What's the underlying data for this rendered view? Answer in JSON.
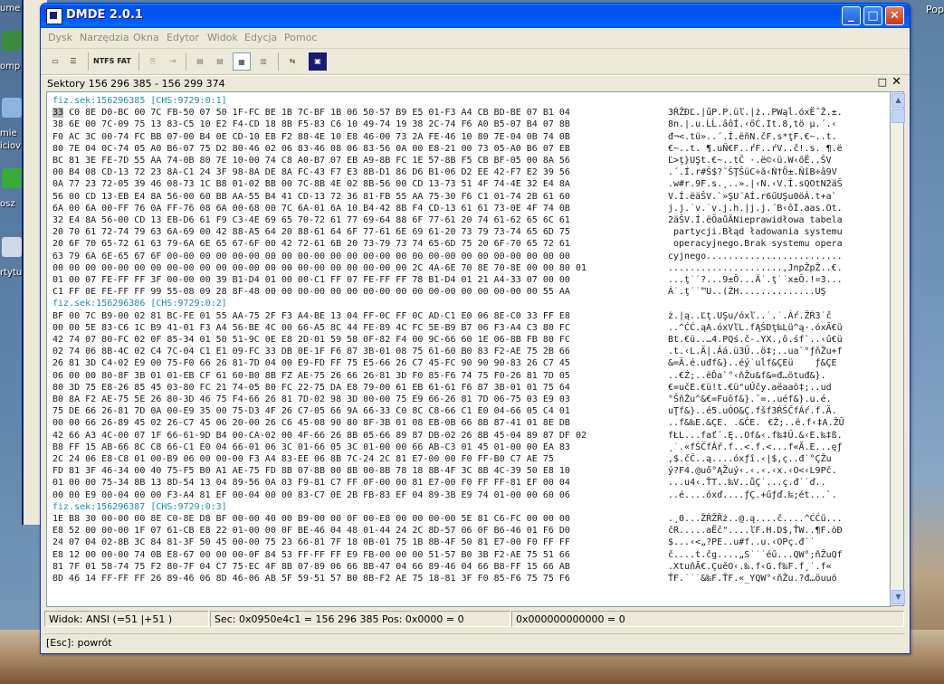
{
  "desktop": {
    "left_labels": [
      "ume",
      "omp",
      "mie",
      "iciov",
      "osz",
      "rtytu"
    ],
    "right_label": "Pop"
  },
  "window": {
    "title": "DMDE 2.0.1",
    "controls": {
      "minimize": "_",
      "maximize": "□",
      "close": "✕"
    }
  },
  "menu": [
    "Dysk",
    "Narzędzia",
    "Okna",
    "Edytor",
    "Widok",
    "Edycja",
    "Pomoc"
  ],
  "toolbar": {
    "ntfs_label": "NTFS",
    "fat_label": "FAT",
    "icons": [
      "drive-icon",
      "partition-icon",
      "ntfs-icon",
      "fat-icon",
      "copy-icon",
      "paste-icon",
      "view-list-icon",
      "view-details-icon",
      "view-hex-icon",
      "view-split-icon",
      "tree-icon",
      "app-icon"
    ]
  },
  "panel": {
    "title": "Sektory 156 296 385 - 156 299 374",
    "maximize": "□",
    "close": "✕"
  },
  "hex": [
    {
      "type": "sec",
      "text": "fiz.sek:156296385 [CHS:9729:0:1]"
    },
    {
      "type": "data",
      "hex": "33 C0 8E D0-BC 00 7C FB-50 07 50 1F-FC BE 1B 7C-BF 1B 06 50-57 B9 E5 01-F3 A4 CB BD-BE 07 B1 04",
      "ascii": "3ŔŽĐĽ.|űP.P.üľ.|ż..PWąĺ.óxË˝Ž.±."
    },
    {
      "type": "data",
      "hex": "38 6E 00 7C-09 75 13 83-C5 10 E2 F4-CD 18 8B F5-83 C6 10 49-74 19 38 2C-74 F6 A0 B5-07 B4 07 8B",
      "ascii": "8n.|.u.ĹĹ.âôÍ.‹őĆ.It.8,tö µ.´.‹"
    },
    {
      "type": "data",
      "hex": "F0 AC 3C 00-74 FC BB 07-00 B4 0E CD-10 EB F2 88-4E 10 E8 46-00 73 2A FE-46 10 80 7E-04 0B 74 0B",
      "ascii": "đ¬<.tü»..´.Í.ëňN.čF.s*ţF.€~..t."
    },
    {
      "type": "data",
      "hex": "80 7E 04 0C-74 05 A0 B6-07 75 D2 80-46 02 06 83-46 08 06 83-56 0A 00 E8-21 00 73 05-A0 B6 07 EB",
      "ascii": "€~..t. ¶.uŇ€F..ŕF..ŕV..č!.s. ¶.ë"
    },
    {
      "type": "data",
      "hex": "BC 81 3E FE-7D 55 AA 74-0B 80 7E 10-00 74 C8 A0-B7 07 EB A9-8B FC 1E 57-8B F5 CB BF-05 00 8A 56",
      "ascii": "Ľ>ţ}UŞt.€~..tČ ·.ë©‹ü.W‹őË..ŠV"
    },
    {
      "type": "data",
      "hex": "00 B4 08 CD-13 72 23 8A-C1 24 3F 98-8A DE 8A FC-43 F7 E3 8B-D1 86 D6 B1-06 D2 EE 42-F7 E2 39 56",
      "ascii": ".´.Í.r#Š$?˜ŠŢŠüC÷ă‹Ń†Ö±.ŇîB÷â9V"
    },
    {
      "type": "data",
      "hex": "0A 77 23 72-05 39 46 08-73 1C B8 01-02 BB 00 7C-8B 4E 02 8B-56 00 CD 13-73 51 4F 74-4E 32 E4 8A",
      "ascii": ".w#r.9F.s.¸..».|‹N.‹V.Í.sQOtN2äŠ"
    },
    {
      "type": "data",
      "hex": "56 00 CD 13-EB E4 8A 56-00 60 BB AA-55 B4 41 CD-13 72 36 81-FB 55 AA 75-30 F6 C1 01-74 2B 61 60",
      "ascii": "V.Í.ëäŠV.`»ŞU´AÍ.r6űUŞu0öÁ.t+a`"
    },
    {
      "type": "data",
      "hex": "6A 00 6A 00-FF 76 0A FF-76 08 6A 00-68 00 7C 6A-01 6A 10 B4-42 8B F4 CD-13 61 61 73-0E 4F 74 0B",
      "ascii": "j.j.˙v.˙v.j.h.|j.j.´B‹ôÍ.aas.Ot."
    },
    {
      "type": "data",
      "hex": "32 E4 8A 56-00 CD 13 EB-D6 61 F9 C3-4E 69 65 70-72 61 77 69-64 88 6F 77-61 20 74 61-62 65 6C 61",
      "ascii": "2äŠV.Í.ëÖaůĂNieprawidłowa tabela"
    },
    {
      "type": "data",
      "hex": "20 70 61 72-74 79 63 6A-69 00 42 88-A5 64 20 88-61 64 6F 77-61 6E 69 61-20 73 79 73-74 65 6D 75",
      "ascii": " partycji.Błąd ładowania systemu"
    },
    {
      "type": "data",
      "hex": "20 6F 70 65-72 61 63 79-6A 6E 65 67-6F 00 42 72-61 6B 20 73-79 73 74 65-6D 75 20 6F-70 65 72 61",
      "ascii": " operacyjnego.Brak systemu opera"
    },
    {
      "type": "data",
      "hex": "63 79 6A 6E-65 67 6F 00-00 00 00 00-00 00 00 00-00 00 00 00-00 00 00 00-00 00 00 00-00 00 00 00",
      "ascii": "cyjnego........................."
    },
    {
      "type": "data",
      "hex": "00 00 00 00-00 00 00 00-00 00 00 00-00 00 00 00-00 00 00 00-00 00 2C 4A-6E 70 8E 70-8E 00 00 80 01",
      "ascii": ".....................,JnpŽpŽ..€."
    },
    {
      "type": "data",
      "hex": "01 00 07 FE-FF FF 3F 00-00 00 39 B1-D4 01 00 00-C1 FF 07 FE-FF FF 78 B1-D4 01 21 A4-33 07 00 00",
      "ascii": "...ţ˙˙?...9±Ô...Á˙.ţ˙˙x±Ô.!¤3..."
    },
    {
      "type": "data",
      "hex": "C1 FF 0E FE-FF FF 99 55-08 09 28 8F-48 00 00 00-00 00 00 00-00 00 00 00-00 00 00 00-00 00 55 AA",
      "ascii": "Á˙.ţ˙˙™U..(ŹH..............UŞ"
    },
    {
      "type": "sec",
      "text": "fiz.sek:156296386 [CHS:9729:0:2]"
    },
    {
      "type": "data",
      "hex": "BF 00 7C B9-00 02 81 BC-FE 01 55 AA-75 2F F3 A4-BE 13 04 FF-0C FF 0C AD-C1 E0 06 8E-C0 33 FF E8",
      "ascii": "ż.|ą..Ľţ.UŞu/óxľ..˙.˙.­Áŕ.ŽŔ3˙č"
    },
    {
      "type": "data",
      "hex": "00 00 5E 83-C6 1C B9 41-01 F3 A4 56-BE 4C 00 66-A5 8C 44 FE-89 4C FC 5E-B9 B7 06 F3-A4 C3 80 FC",
      "ascii": "..^ĆĆ.ąA.óxVľL.fĄŚDţ‰Lü^ą·.óxĂ€ü"
    },
    {
      "type": "data",
      "hex": "42 74 07 80-FC 02 0F 85-34 01 50 51-9C 0E E8 2D-01 59 58 0F-82 F4 00 9C-66 60 1E 06-8B FB 80 FC",
      "ascii": "Bt.€ü..…4.PQś.č-.YX.‚ô.śf`..‹ű€ü"
    },
    {
      "type": "data",
      "hex": "02 74 06 8B-4C 02 C4 7C-04 C1 E1 09-FC 33 DB 0E-1F F6 87 3B-01 08 75 61-60 B0 83 F2-AE 75 2B 66",
      "ascii": ".t.‹L.Ä|.Áá.ü3Ű..ö‡;..ua`°ƒňŽu+f"
    },
    {
      "type": "data",
      "hex": "26 81 3D C4-02 E9 00 75-F0 66 26 81-7D 04 00 E9-FD FF 75 E5-66 26 C7 45-FC 90 90 90-83 26 C7 45",
      "ascii": "&=Ä.é.uđf&}..éý˙uĺf&ÇEüƒ&ÇE"
    },
    {
      "type": "data",
      "hex": "06 00 00 80-8F 3B 01 01-EB CF 61 60-B0 8B FZ AE-75 26 66 26-81 3D F0 85-F6 74 75 F0-26 81 7D 05",
      "ascii": "..€Ź;..ëĎa`°‹ňŽu&f&=đ…ötuđ&}."
    },
    {
      "type": "data",
      "hex": "80 3D 75 E8-26 85 45 03-80 FC 21 74-05 80 FC 22-75 DA E8 79-00 61 EB 61-61 F6 87 3B-01 01 75 64",
      "ascii": "€=učE.€ü!t.€ü\"uÚčy.aëaaö‡;..ud"
    },
    {
      "type": "data",
      "hex": "B0 8A F2 AE-75 5E 26 80-3D 46 75 F4-66 26 81 7D-02 98 3D 00-00 75 E9 66-26 81 7D 06-75 03 E9 03",
      "ascii": "°ŠňŽu^&€=Fuôf&}.˜=..uéf&}.u.é."
    },
    {
      "type": "data",
      "hex": "75 DE 66 26-81 7D 0A 00-E9 35 00 75-D3 4F 26 C7-05 66 9A 66-33 C0 8C C8-66 C1 E0 04-66 05 C4 01",
      "ascii": "uŢf&}..é5.uÓO&Ç.fšf3ŔŚČfÁŕ.f.Ä."
    },
    {
      "type": "data",
      "hex": "00 00 66 26-89 45 02 26-C7 45 06 20-00 26 C6 45-08 90 80 8F-3B 01 08 EB-0B 66 8B 87-41 01 8E DB",
      "ascii": "..f&‰E.&ÇE. .&ĆE.€Ź;..ë.f‹‡A.ŽŰ"
    },
    {
      "type": "data",
      "hex": "42 66 A3 4C-00 07 1F 66-61-9D B4 00-CA-02 00 4F-66 26 8B 05-66 89 87 DB-02 26 8B 45-04 89 87 DF 02",
      "ascii": "fŁL...fať´.Ę..Of&‹.f‰‡Ű.&‹E.‰‡ß."
    },
    {
      "type": "data",
      "hex": "B8 FF 15 AB-66 8C C8 66-C1 E0 04 66-01 06 3C 01-66 05 3C 01-00 00 66 AB-C3 01 45 01-00 00 EA 83",
      "ascii": "¸˙.«fŚČfÁŕ.f..<.f.<...f«Ă.E...ęƒ"
    },
    {
      "type": "data",
      "hex": "2C 24 06 E8-C8 01 00-B9 06 00 00-00 F3 A4 83-EE 06 8B 7C-24 2C 81 E7-00 00 F0 FF-B0 C7 AE 75",
      "ascii": ",$.čČ..ą....óxƒî.‹|$,ç..đ˙°ÇŽu"
    },
    {
      "type": "data",
      "hex": "FD 81 3F 46-34 00 40 75-F5 B0 A1 AE-75 FD 8B 07-8B 00 8B 00-8B 78 18 8B-4F 3C 8B 4C-39 50 E8 10",
      "ascii": "ý?F4.@uő°ĄŽuý‹.‹.‹.‹x.‹O<‹L9Pč."
    },
    {
      "type": "data",
      "hex": "01 00 00 75-34 8B 13 8D-54 13 04 89-56 0A 03 F9-81 C7 FF 0F-00 00 81 E7-00 F0 FF FF-81 EF 00 04",
      "ascii": "...u4‹.ŤT..‰V..ůÇ˙...ç.đ˙˙ď.."
    },
    {
      "type": "data",
      "hex": "00 00 E9 00-04 00 00 F3-A4 81 EF 00-04 00 00 83-C7 0E 2B FB-83 EF 04 89-3B E9 74 01-00 00 60 06",
      "ascii": "..é....óxď....ƒÇ.+űƒď.‰;ét...`."
    },
    {
      "type": "sec",
      "text": "fiz.sek:156296387 [CHS:9729:0:3]"
    },
    {
      "type": "data",
      "hex": "1E B8 30 00-00 00 8E C0-8E D8 BF 00-00 40 00 B9-00 00 0F 00-E8 00 00 00-00 5E 81 C6-FC 00 00 00",
      "ascii": ".¸0...ŽŔŽŘż..@.ą....č....^ĆĆü..."
    },
    {
      "type": "data",
      "hex": "E8 52 00 00-00 1F 07 61-CB E8 22 01-00 00 0F BE-46 04 48 01-44 24 2C 8D-57 06 0F B6-46 01 F6 D0",
      "ascii": "čR.....aËč\"....ľF.H.D$,ŤW..¶F.öĐ"
    },
    {
      "type": "data",
      "hex": "24 07 04 02-8B 3C 84 81-3F 50 45 00-00 75 23 66-81 7F 18 0B-01 75 1B 8B-4F 50 81 E7-00 F0 FF FF",
      "ascii": "$...‹<„?PE..u#f..u.‹OPç.đ˙˙"
    },
    {
      "type": "data",
      "hex": "E8 12 00 00-00 74 0B E8-67 00 00 00-0F 84 53 FF-FF FF E9 FB-00 00 00 51-57 B0 3B F2-AE 75 51 66",
      "ascii": "č....t.čg....„S˙˙˙éű...QW°;ňŽuQf"
    },
    {
      "type": "data",
      "hex": "81 7F 01 58-74 75 F2 80-7F 04 C7 75-EC 4F 8B 07-89 06 66 8B-47 04 66 89-46 04 66 B8-FF 15 66 AB",
      "ascii": ".XtuňĂ€.ÇuěO‹.‰.f‹G.f‰F.f¸˙.f«"
    },
    {
      "type": "data",
      "hex": "8D 46 14 FF-FF FF 26 89-46 06 8D 46-06 AB 5F 59-51 57 B0 8B-F2 AE 75 18-81 3F F0 85-F6 75 75 F6",
      "ascii": "ŤF.˙˙˙&‰F.ŤF.«_YQW°‹ňŽu.?đ…öuuö"
    }
  ],
  "status": {
    "view": "Widok: ANSI (=51 |+51 )",
    "sector": "Sec: 0x0950e4c1 = 156 296 385  Pos: 0x0000 = 0",
    "offset": "0x000000000000 = 0"
  },
  "hint": "[Esc]: powrót"
}
